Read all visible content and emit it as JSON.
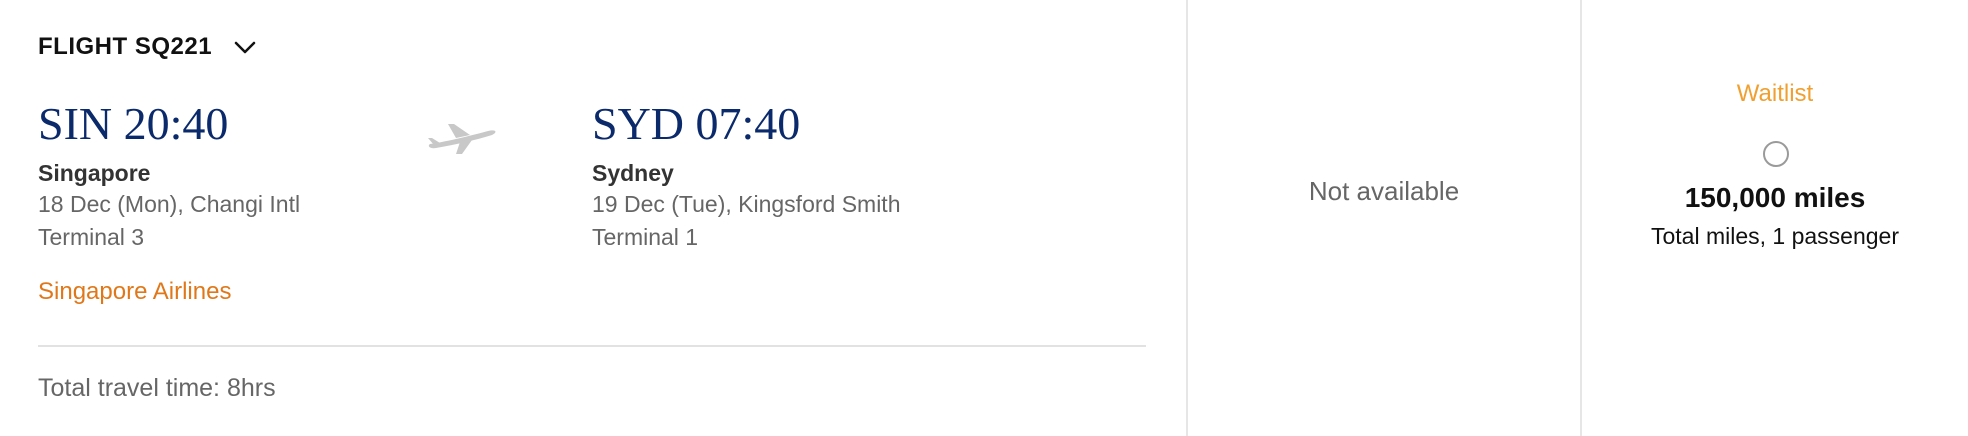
{
  "flight": {
    "number_label": "FLIGHT SQ221",
    "toggle_icon": "chevron-down-icon",
    "origin": {
      "code_time": "SIN 20:40",
      "city": "Singapore",
      "date_airport": "18 Dec (Mon), Changi Intl",
      "terminal": "Terminal 3"
    },
    "destination": {
      "code_time": "SYD 07:40",
      "city": "Sydney",
      "date_airport": "19 Dec (Tue), Kingsford Smith",
      "terminal": "Terminal 1"
    },
    "plane_icon": "airplane-icon",
    "airline": "Singapore Airlines",
    "travel_time": "Total travel time: 8hrs"
  },
  "fares": {
    "column_1": {
      "status": "Not available"
    },
    "column_2": {
      "status": "Waitlist",
      "miles": "150,000 miles",
      "caption": "Total miles, 1 passenger",
      "selected": false
    }
  },
  "colors": {
    "brand_navy": "#0b2a6b",
    "airline_orange": "#e0781a",
    "waitlist_amber": "#f0a030",
    "muted_text": "#666666"
  }
}
